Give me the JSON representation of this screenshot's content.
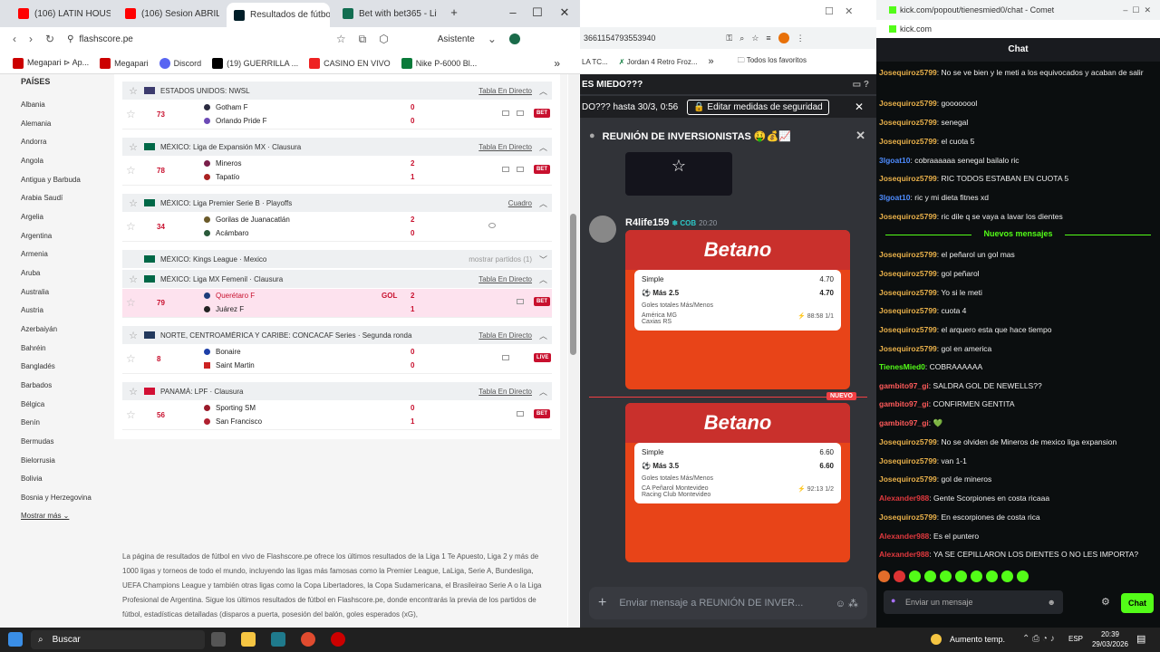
{
  "chrome": {
    "tabs": [
      {
        "label": "(106) LATIN HOUSE Y",
        "color": "#ff0000"
      },
      {
        "label": "(106) Sesion ABRIL 2",
        "color": "#ff0000"
      },
      {
        "label": "Resultados de fútbol",
        "color": "#001e28"
      },
      {
        "label": "Bet with bet365 - Liv",
        "color": "#126e51"
      }
    ],
    "new_tab": "+",
    "url": "flashscore.pe",
    "assistant": "Asistente",
    "bookmarks": [
      "Megapari ⊳ Ap...",
      "Megapari",
      "Discord",
      "(19) GUERRILLA ...",
      "CASINO EN VIVO",
      "Nike P-6000 Bl..."
    ],
    "more_bookmarks": "»"
  },
  "flashscore": {
    "countries_title": "PAÍSES",
    "countries": [
      "Albania",
      "Alemania",
      "Andorra",
      "Angola",
      "Antigua y Barbuda",
      "Arabia Saudí",
      "Argelia",
      "Argentina",
      "Armenia",
      "Aruba",
      "Australia",
      "Austria",
      "Azerbaiyán",
      "Bahréin",
      "Bangladés",
      "Barbados",
      "Bélgica",
      "Benín",
      "Bermudas",
      "Bielorrusia",
      "Bolivia",
      "Bosnia y Herzegovina"
    ],
    "more": "Mostrar más",
    "leagues": [
      {
        "title": "ESTADOS UNIDOS: NWSL",
        "link": "Tabla En Directo",
        "flag_color": "#3c3b6e"
      },
      {
        "title": "MÉXICO: Liga de Expansión MX · Clausura",
        "link": "Tabla En Directo",
        "flag_color": "#006847"
      },
      {
        "title": "MÉXICO: Liga Premier Serie B · Playoffs",
        "link": "Cuadro",
        "flag_color": "#006847"
      },
      {
        "title": "MÉXICO: Kings League · Mexico",
        "link": "mostrar partidos (1)",
        "flag_color": "#006847"
      },
      {
        "title": "MÉXICO: Liga MX Femenil · Clausura",
        "link": "Tabla En Directo",
        "flag_color": "#006847"
      },
      {
        "title": "NORTE, CENTROAMÉRICA Y CARIBE: CONCACAF Series · Segunda ronda",
        "link": "Tabla En Directo",
        "flag_color": "#23395d"
      },
      {
        "title": "PANAMÁ: LPF · Clausura",
        "link": "Tabla En Directo",
        "flag_color": "#d21034"
      }
    ],
    "matches": [
      {
        "minute": "73",
        "home": "Gotham F",
        "away": "Orlando Pride F",
        "hs": "0",
        "as": "0",
        "badge": "BET"
      },
      {
        "minute": "78",
        "home": "Mineros",
        "away": "Tapatío",
        "hs": "2",
        "as": "1",
        "badge": "BET"
      },
      {
        "minute": "34",
        "home": "Gorilas de Juanacatlán",
        "away": "Acámbaro",
        "hs": "2",
        "as": "0",
        "badge": ""
      },
      {
        "minute": "79",
        "home": "Querétaro F",
        "away": "Juárez F",
        "hs": "2",
        "as": "1",
        "badge": "BET",
        "gol": "GOL"
      },
      {
        "minute": "8",
        "home": "Bonaire",
        "away": "Saint Martin",
        "hs": "0",
        "as": "0",
        "badge": "LIVE"
      },
      {
        "minute": "56",
        "home": "Sporting SM",
        "away": "San Francisco",
        "hs": "0",
        "as": "1",
        "badge": "BET"
      }
    ],
    "seo": "La página de resultados de fútbol en vivo de Flashscore.pe ofrece los últimos resultados de la Liga 1 Te Apuesto, Liga 2 y más de 1000 ligas y torneos de todo el mundo, incluyendo las ligas más famosas como la Premier League, LaLiga, Serie A, Bundesliga, UEFA Champions League y también otras ligas como la Copa Libertadores, la Copa Sudamericana, el Brasileirao Serie A o la Liga Profesional de Argentina. Sigue los últimos resultados de fútbol en Flashscore.pe, donde encontrarás la previa de los partidos de fútbol, estadísticas detalladas (disparos a puerta, posesión del balón, goles esperados (xG),"
  },
  "discord": {
    "url_fragment": "3661154793553940",
    "bookmarks": [
      "LA TC...",
      "Jordan 4 Retro Froz...",
      "»",
      "Todos los favoritos"
    ],
    "banner_left": "ES MIEDO???",
    "banner_text": "DO??? hasta 30/3, 0:56",
    "banner_button": "Editar medidas de seguridad",
    "channel": "REUNIÓN DE INVERSIONISTAS 🤑💰📈",
    "author": "R4life159",
    "role": "COB",
    "time": "20:20",
    "new_label": "NUEVO",
    "bets": [
      {
        "logo": "Betano",
        "type": "Simple",
        "odds": "4.70",
        "pick": "Más 2.5",
        "pick_odds": "4.70",
        "market": "Goles totales Más/Menos",
        "home": "América MG",
        "away": "Caxias RS",
        "clock": "88:58",
        "hs": "1",
        "as": "1"
      },
      {
        "logo": "Betano",
        "type": "Simple",
        "odds": "6.60",
        "pick": "Más 3.5",
        "pick_odds": "6.60",
        "market": "Goles totales Más/Menos",
        "home": "CA Peñarol Montevideo",
        "away": "Racing Club Montevideo",
        "clock": "92:13",
        "hs": "1",
        "as": "2"
      }
    ],
    "input_placeholder": "Enviar mensaje a REUNIÓN DE INVER..."
  },
  "kick": {
    "title": "kick.com/popout/tienesmied0/chat - Comet",
    "address": "kick.com",
    "header": "Chat",
    "new_messages": "Nuevos mensajes",
    "messages": [
      {
        "user": "Josequiroz5799",
        "color": "#e8b04a",
        "text": "No se ve bien y le meti a los equivocados y acaban de salir"
      },
      {
        "user": "Josequiroz5799",
        "color": "#e8b04a",
        "text": "goooooool"
      },
      {
        "user": "Josequiroz5799",
        "color": "#e8b04a",
        "text": "senegal"
      },
      {
        "user": "Josequiroz5799",
        "color": "#e8b04a",
        "text": "el cuota 5"
      },
      {
        "user": "3lgoat10",
        "color": "#4e8cff",
        "text": "cobraaaaaa senegal bailalo ric"
      },
      {
        "user": "Josequiroz5799",
        "color": "#e8b04a",
        "text": "RIC TODOS ESTABAN EN CUOTA 5"
      },
      {
        "user": "3lgoat10",
        "color": "#4e8cff",
        "text": "ric y mi dieta fitnes xd"
      },
      {
        "user": "Josequiroz5799",
        "color": "#e8b04a",
        "text": "ric dile q se vaya a lavar los dientes"
      },
      {
        "user": "Josequiroz5799",
        "color": "#e8b04a",
        "text": "el peñarol un gol mas"
      },
      {
        "user": "Josequiroz5799",
        "color": "#e8b04a",
        "text": "gol peñarol"
      },
      {
        "user": "Josequiroz5799",
        "color": "#e8b04a",
        "text": "Yo si le meti"
      },
      {
        "user": "Josequiroz5799",
        "color": "#e8b04a",
        "text": "cuota 4"
      },
      {
        "user": "Josequiroz5799",
        "color": "#e8b04a",
        "text": "el arquero esta que hace tiempo"
      },
      {
        "user": "Josequiroz5799",
        "color": "#e8b04a",
        "text": "gol en america"
      },
      {
        "user": "TienesMied0",
        "color": "#53fc18",
        "text": "COBRAAAAAA"
      },
      {
        "user": "gambito97_gi",
        "color": "#ff5a5a",
        "text": "SALDRA GOL DE NEWELLS??"
      },
      {
        "user": "gambito97_gi",
        "color": "#ff5a5a",
        "text": "CONFIRMEN GENTITA"
      },
      {
        "user": "gambito97_gi",
        "color": "#ff5a5a",
        "text": "💚"
      },
      {
        "user": "Josequiroz5799",
        "color": "#e8b04a",
        "text": "No se olviden de Mineros de mexico liga expansion"
      },
      {
        "user": "Josequiroz5799",
        "color": "#e8b04a",
        "text": "van 1-1"
      },
      {
        "user": "Josequiroz5799",
        "color": "#e8b04a",
        "text": "gol de mineros"
      },
      {
        "user": "Alexander988",
        "color": "#e0393e",
        "text": "Gente Scorpiones en costa ricaaa"
      },
      {
        "user": "Josequiroz5799",
        "color": "#e8b04a",
        "text": "En escorpiones de costa rica"
      },
      {
        "user": "Alexander988",
        "color": "#e0393e",
        "text": "Es el puntero"
      },
      {
        "user": "Alexander988",
        "color": "#e0393e",
        "text": "YA SE CEPILLARON LOS DIENTES O NO LES IMPORTA?"
      }
    ],
    "input_placeholder": "Enviar un mensaje",
    "chat_button": "Chat"
  },
  "taskbar": {
    "search": "Buscar",
    "weather": "Aumento temp.",
    "lang": "ESP",
    "time": "20:39",
    "date": "29/03/2026"
  }
}
